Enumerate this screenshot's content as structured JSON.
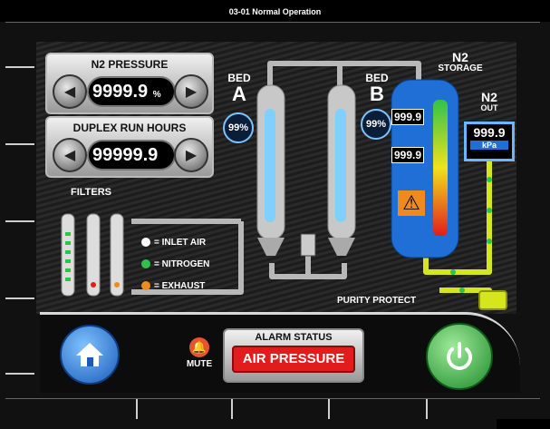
{
  "window": {
    "title": "03-01 Normal Operation"
  },
  "n2_pressure": {
    "label": "N2 PRESSURE",
    "value": "9999.9",
    "unit": "%"
  },
  "duplex_run_hours": {
    "label": "DUPLEX RUN HOURS",
    "value": "99999.9"
  },
  "bed_a": {
    "label_top": "BED",
    "label_letter": "A",
    "percent": "99%"
  },
  "bed_b": {
    "label_top": "BED",
    "label_letter": "B",
    "percent": "99%"
  },
  "storage": {
    "title_main": "N2",
    "title_sub": "STORAGE",
    "reading_top": "999.9",
    "reading_mid": "999.9"
  },
  "n2_out": {
    "title_main": "N2",
    "title_sub": "OUT",
    "value": "999.9",
    "unit": "kPa"
  },
  "filters": {
    "label": "FILTERS"
  },
  "legend": [
    {
      "label": "= INLET AIR",
      "color": "#ffffff"
    },
    {
      "label": "= NITROGEN",
      "color": "#2fc24a"
    },
    {
      "label": "= EXHAUST",
      "color": "#f08a1c"
    }
  ],
  "purity_protect": {
    "label": "PURITY PROTECT"
  },
  "mute": {
    "label": "MUTE"
  },
  "alarm": {
    "title": "ALARM STATUS",
    "message": "AIR PRESSURE"
  },
  "colors": {
    "accent_blue": "#1f6fd6",
    "nitrogen": "#2fc24a",
    "alarm_red": "#e21c1c",
    "power_green": "#2fae3a",
    "pipe": "#b8b8b8",
    "out_pipe": "#d6e61c"
  },
  "icons": [
    "home-icon",
    "power-icon",
    "bell-icon",
    "warning-icon",
    "left-arrow-icon",
    "right-arrow-icon"
  ]
}
